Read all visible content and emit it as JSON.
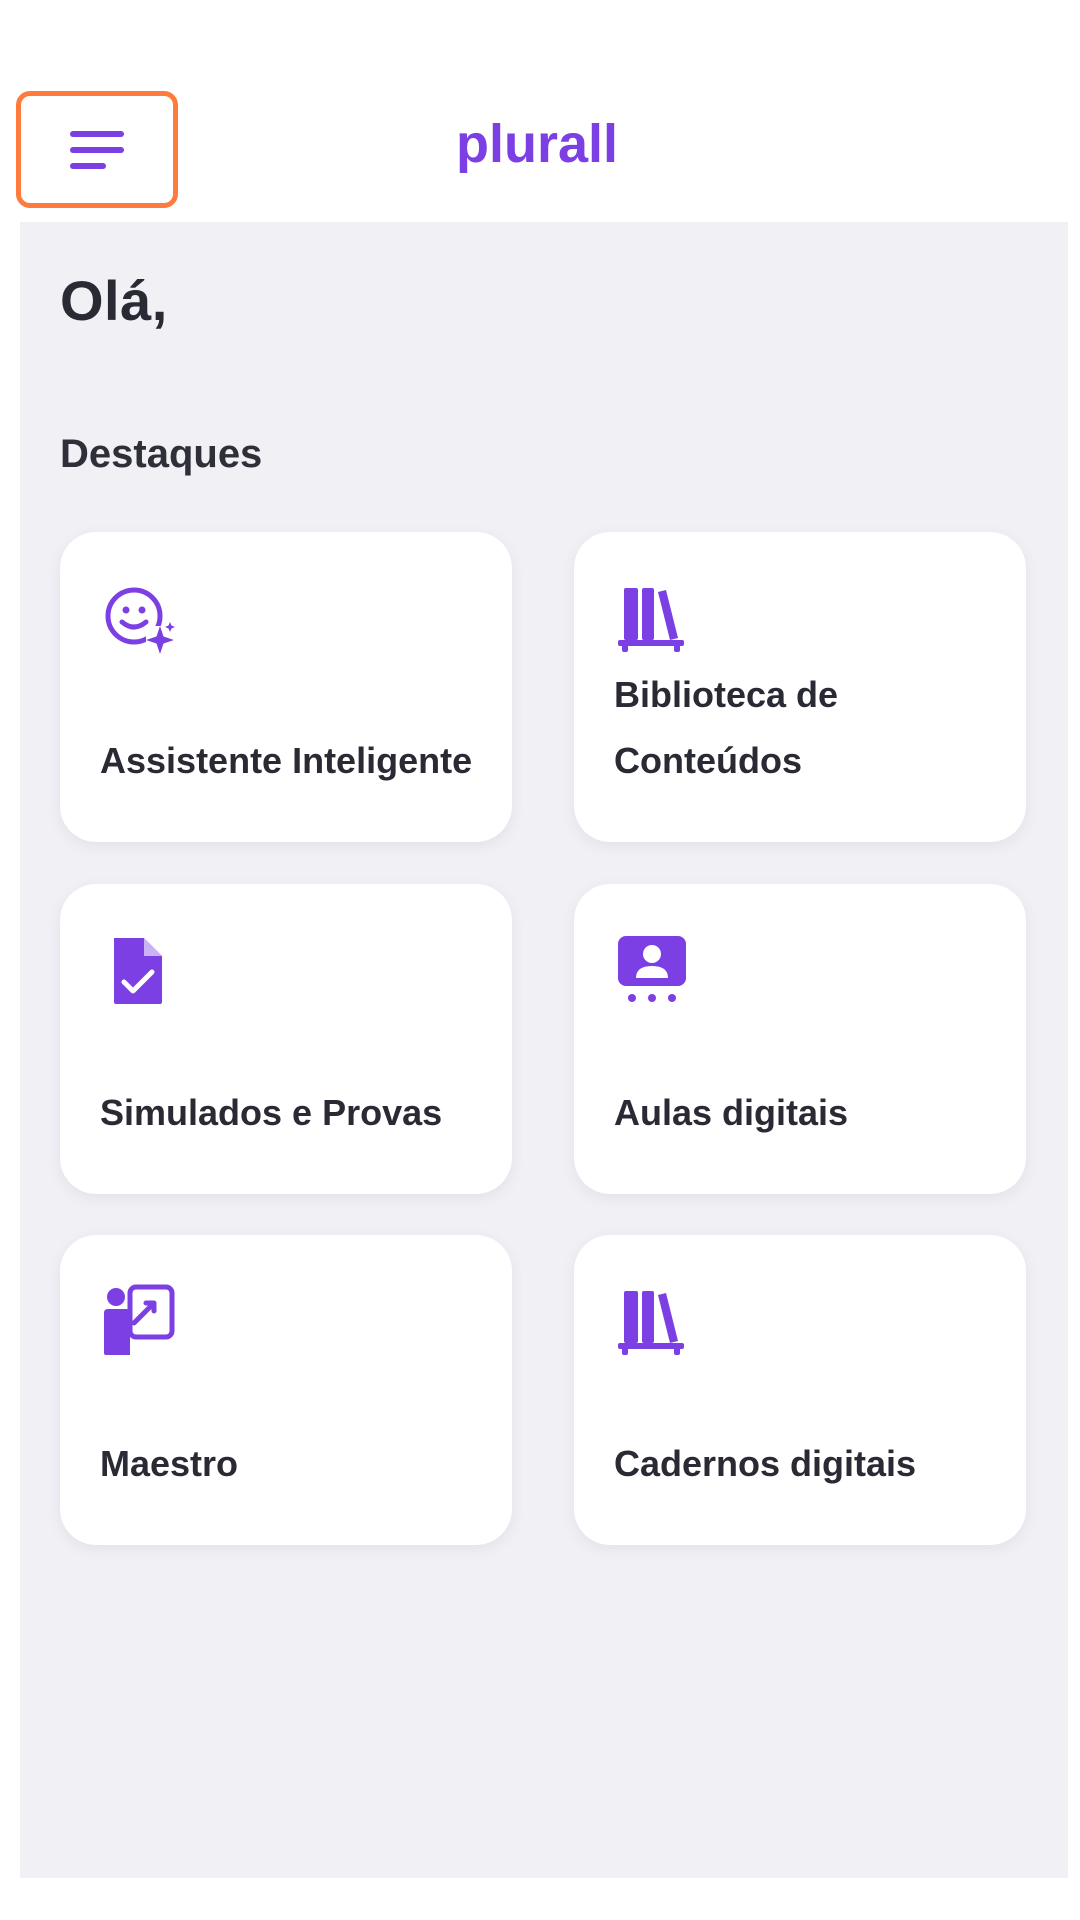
{
  "header": {
    "menu_icon": "hamburger-menu-icon",
    "logo_text": "plurall",
    "accent_color": "#7b3fe4",
    "highlight_color": "#ff7a3d"
  },
  "greeting": "Olá,",
  "highlights": {
    "title": "Destaques",
    "cards": [
      {
        "label": "Assistente Inteligente",
        "icon": "smiley-sparkle-icon"
      },
      {
        "label": "Biblioteca de Conteúdos",
        "icon": "bookshelf-icon"
      },
      {
        "label": "Simulados e Provas",
        "icon": "document-check-icon"
      },
      {
        "label": "Aulas digitais",
        "icon": "presentation-person-icon"
      },
      {
        "label": "Maestro",
        "icon": "teacher-board-icon"
      },
      {
        "label": "Cadernos digitais",
        "icon": "bookshelf-icon"
      }
    ]
  }
}
